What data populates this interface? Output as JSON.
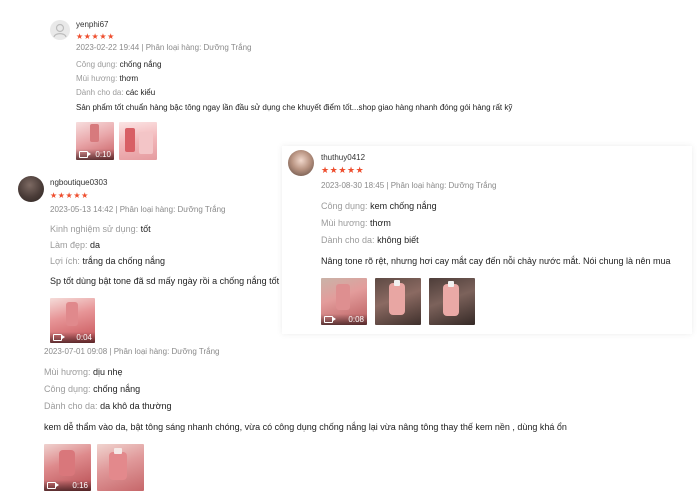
{
  "reviews": [
    {
      "username": "yenphi67",
      "stars": "★★★★★",
      "meta": "2023-02-22 19:44 | Phân loại hàng: Dưỡng Trắng",
      "attrs": [
        {
          "k": "Công dụng:",
          "v": "chống nắng"
        },
        {
          "k": "Mùi hương:",
          "v": "thơm"
        },
        {
          "k": "Dành cho da:",
          "v": "các kiểu"
        }
      ],
      "comment": "Sản phẩm tốt chuẩn hàng bậc tông ngay lần đầu sử dụng che khuyết điểm tốt...shop giao hàng nhanh đóng gói hàng rất kỹ",
      "video_duration": "0:10"
    },
    {
      "username": "ngboutique0303",
      "stars": "★★★★★",
      "meta": "2023-05-13 14:42 | Phân loại hàng: Dưỡng Trắng",
      "attrs": [
        {
          "k": "Kinh nghiệm sử dụng:",
          "v": "tốt"
        },
        {
          "k": "Làm đẹp:",
          "v": "da"
        },
        {
          "k": "Lợi ích:",
          "v": "trắng da chống nắng"
        }
      ],
      "comment": "Sp tốt dùng bật tone đã sd mấy ngày rồi a chống nắng tốt",
      "video_duration": "0:04"
    },
    {
      "username": "thuthuy0412",
      "stars": "★★★★★",
      "meta": "2023-08-30 18:45 | Phân loại hàng: Dưỡng Trắng",
      "attrs": [
        {
          "k": "Công dụng:",
          "v": "kem chống nắng"
        },
        {
          "k": "Mùi hương:",
          "v": "thơm"
        },
        {
          "k": "Dành cho da:",
          "v": "không biết"
        }
      ],
      "comment": "Nâng tone rõ rệt, nhưng hơi cay mắt cay đến nỗi chảy nước mắt. Nói chung là nên mua",
      "video_duration": "0:08"
    },
    {
      "meta": "2023-07-01 09:08 | Phân loại hàng: Dưỡng Trắng",
      "attrs": [
        {
          "k": "Mùi hương:",
          "v": "dịu nhẹ"
        },
        {
          "k": "Công dụng:",
          "v": "chống nắng"
        },
        {
          "k": "Dành cho da:",
          "v": "da khô da thường"
        }
      ],
      "comment": "kem dễ thẩm vào da, bật tông sáng nhanh chóng, vừa có công dụng chống nắng lại vừa nâng tông thay thế kem nền , dùng khá ổn",
      "video_duration": "0:16"
    }
  ],
  "colors": {
    "star": "#ee4d2d",
    "label_gray": "#9b9b9b",
    "meta_gray": "#8a8a8a",
    "thumb_pink": "#e8a4a6",
    "thumb_dark": "#c85a5e"
  }
}
